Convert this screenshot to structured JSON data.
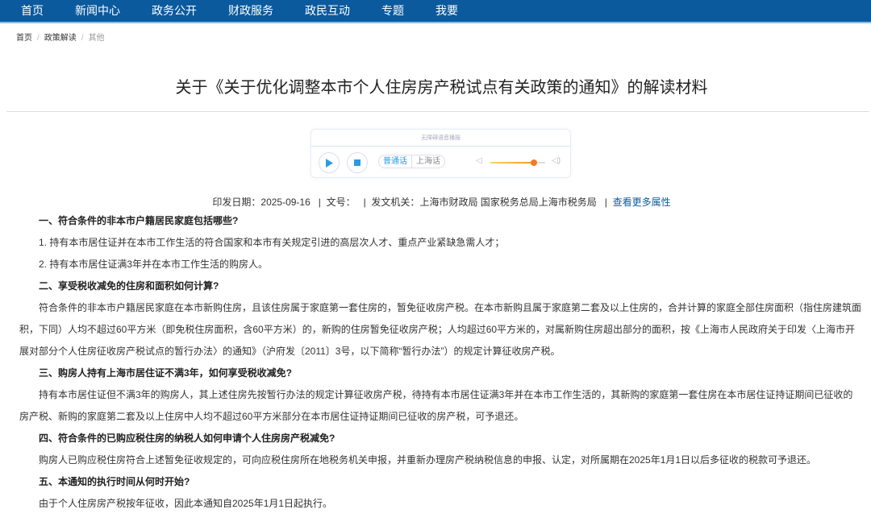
{
  "nav": [
    "首页",
    "新闻中心",
    "政务公开",
    "财政服务",
    "政民互动",
    "专题",
    "我要"
  ],
  "breadcrumb": [
    "首页",
    "政策解读",
    "其他"
  ],
  "breadcrumb_sep": "/",
  "title": "关于《关于优化调整本市个人住房房产税试点有关政策的通知》的解读材料",
  "player": {
    "title": "无障碍语音播报",
    "lang_active": "普通话",
    "lang_other": "上海话",
    "volume": 0.8
  },
  "meta": {
    "date_label": "印发日期：",
    "date": "2025-09-16",
    "docno_label": "文号：",
    "docno": "",
    "issuer_label": "发文机关：",
    "issuer": "上海市财政局 国家税务总局上海市税务局",
    "sep": "|",
    "more": "查看更多属性"
  },
  "content": [
    {
      "type": "h",
      "text": "一、符合条件的非本市户籍居民家庭包括哪些?"
    },
    {
      "type": "p",
      "text": "1. 持有本市居住证并在本市工作生活的符合国家和本市有关规定引进的高层次人才、重点产业紧缺急需人才；"
    },
    {
      "type": "p",
      "text": "2. 持有本市居住证满3年并在本市工作生活的购房人。"
    },
    {
      "type": "h",
      "text": "二、享受税收减免的住房和面积如何计算?"
    },
    {
      "type": "p",
      "text": "符合条件的非本市户籍居民家庭在本市新购住房，且该住房属于家庭第一套住房的，暂免征收房产税。在本市新购且属于家庭第二套及以上住房的，合并计算的家庭全部住房面积（指住房建筑面积，下同）人均不超过60平方米（即免税住房面积，含60平方米）的，新购的住房暂免征收房产税；人均超过60平方米的，对属新购住房超出部分的面积，按《上海市人民政府关于印发〈上海市开展对部分个人住房征收房产税试点的暂行办法〉的通知》（沪府发〔2011〕3号，以下简称“暂行办法”）的规定计算征收房产税。"
    },
    {
      "type": "h",
      "text": "三、购房人持有上海市居住证不满3年，如何享受税收减免?"
    },
    {
      "type": "p",
      "text": "持有本市居住证但不满3年的购房人，其上述住房先按暂行办法的规定计算征收房产税，待持有本市居住证满3年并在本市工作生活的，其新购的家庭第一套住房在本市居住证持证期间已征收的房产税、新购的家庭第二套及以上住房中人均不超过60平方米部分在本市居住证持证期间已征收的房产税，可予退还。"
    },
    {
      "type": "h",
      "text": "四、符合条件的已购应税住房的纳税人如何申请个人住房房产税减免?"
    },
    {
      "type": "p",
      "text": "购房人已购应税住房符合上述暂免征收规定的，可向应税住房所在地税务机关申报，并重新办理房产税纳税信息的申报、认定，对所属期在2025年1月1日以后多征收的税款可予退还。"
    },
    {
      "type": "h",
      "text": "五、本通知的执行时间从何时开始?"
    },
    {
      "type": "p",
      "text": "由于个人住房房产税按年征收，因此本通知自2025年1月1日起执行。"
    }
  ]
}
